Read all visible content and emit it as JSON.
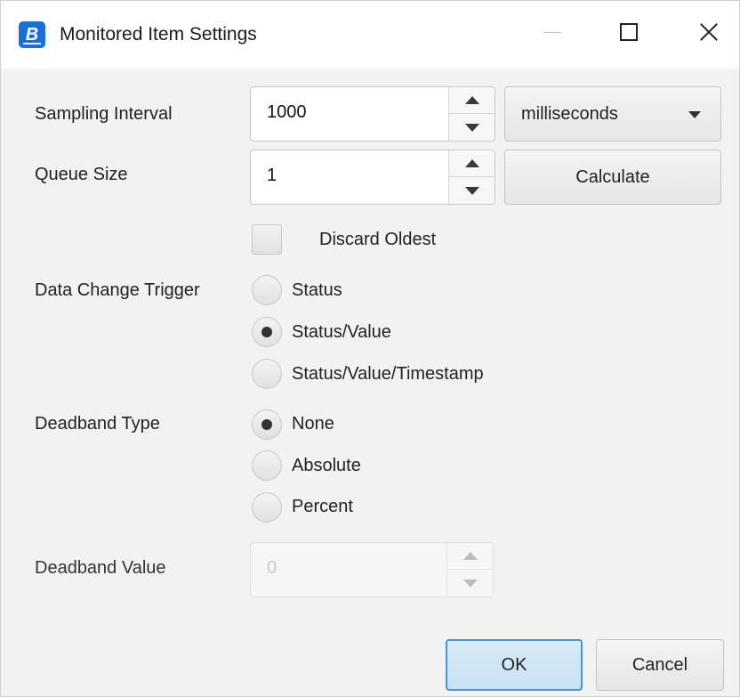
{
  "window": {
    "title": "Monitored Item Settings",
    "app_icon_letter": "B"
  },
  "sampling": {
    "label": "Sampling Interval",
    "value": "1000",
    "unit_selected": "milliseconds"
  },
  "queue": {
    "label": "Queue Size",
    "value": "1",
    "calculate_label": "Calculate"
  },
  "discard_oldest": {
    "label": "Discard Oldest",
    "checked": false
  },
  "data_change_trigger": {
    "label": "Data Change Trigger",
    "options": [
      "Status",
      "Status/Value",
      "Status/Value/Timestamp"
    ],
    "selected": "Status/Value"
  },
  "deadband_type": {
    "label": "Deadband Type",
    "options": [
      "None",
      "Absolute",
      "Percent"
    ],
    "selected": "None"
  },
  "deadband_value": {
    "label": "Deadband Value",
    "value": "0",
    "enabled": false
  },
  "footer": {
    "ok_label": "OK",
    "cancel_label": "Cancel"
  },
  "colors": {
    "accent_border": "#4a94d6",
    "ok_background": "#c8e1f3",
    "app_icon": "#1d6fd6",
    "dialog_background": "#f2f2f2"
  },
  "icons": [
    "app-logo-icon",
    "minimize-icon",
    "maximize-icon",
    "close-icon",
    "chevron-up-icon",
    "chevron-down-icon",
    "dropdown-caret-icon"
  ]
}
